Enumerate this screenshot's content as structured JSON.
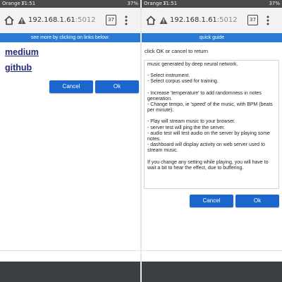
{
  "status_bar": {
    "carrier": "Orange F",
    "time": "11:51",
    "right": "37%"
  },
  "browser": {
    "url_host": "192.168.1.61",
    "url_port": ":5012",
    "tab_count": "37"
  },
  "left": {
    "banner": "see more by clicking on links below:",
    "links": [
      "medium",
      "github"
    ],
    "cancel_label": "Cancel",
    "ok_label": "Ok"
  },
  "right": {
    "banner": "quick guide",
    "instruction": "click OK or cancel to return",
    "guide_lines": [
      "music generated by deep neural network.",
      "",
      "- Select instrument.",
      "- Select corpus used for training.",
      "",
      "- Increase 'temperature' to add randomness in notes generation.",
      "- Change tempo, ie 'speed' of the music, with BPM (beats per minute).",
      "",
      "- Play will stream music to your browser.",
      "- server test will ping the the server.",
      "- audio test will test audio on the server by playing some notes.",
      "- dashboard will display activity on web server used to stream music.",
      "",
      "If you change any setting while playing, you will have to wait a bit to hear the effect, due to buffering."
    ],
    "cancel_label": "Cancel",
    "ok_label": "Ok"
  },
  "colors": {
    "banner": "#2b7bd6",
    "button": "#1a66cc",
    "link": "#232a73"
  }
}
